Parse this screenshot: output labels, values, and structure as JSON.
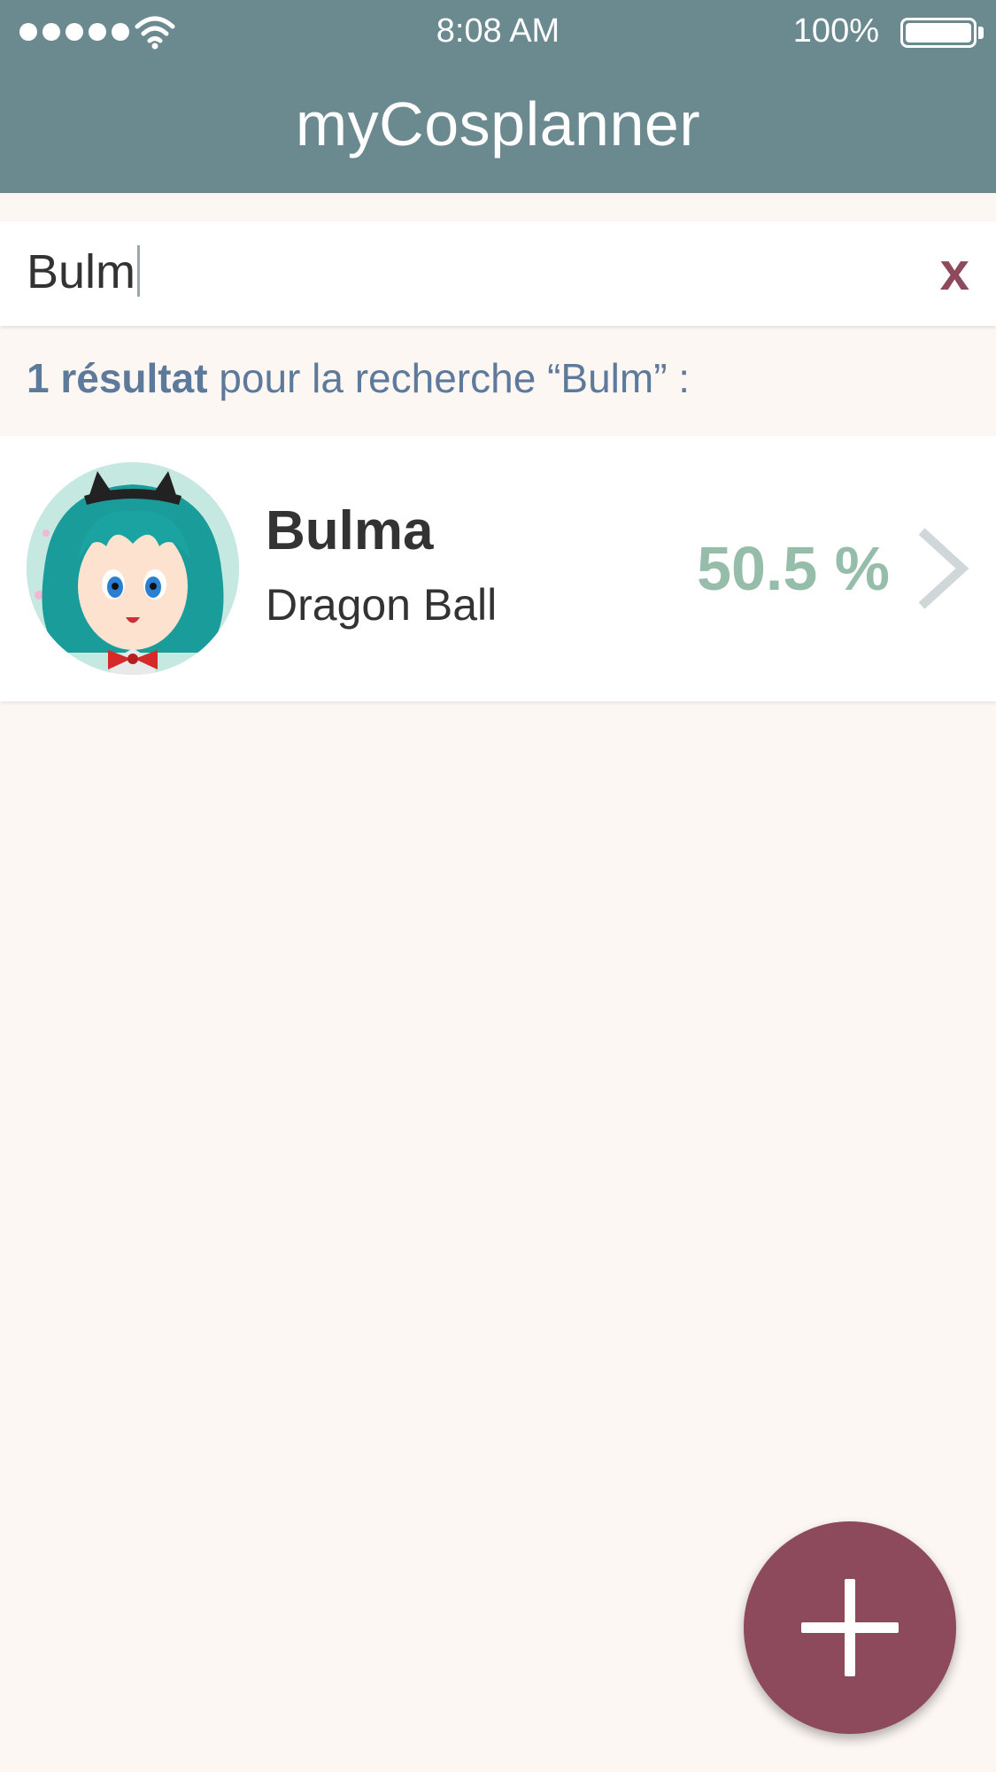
{
  "status_bar": {
    "time": "8:08 AM",
    "battery": "100%"
  },
  "header": {
    "title": "myCosplanner"
  },
  "search": {
    "value": "Bulm",
    "clear_label": "x"
  },
  "results": {
    "count_label": "1 résultat",
    "rest_label": " pour la recherche “Bulm” :"
  },
  "items": [
    {
      "name": "Bulma",
      "series": "Dragon Ball",
      "progress_label": "50.5 %",
      "progress": 50.5
    }
  ],
  "colors": {
    "header": "#6b8a90",
    "background": "#fdf7f4",
    "accent": "#8e4a5d",
    "progress": "#95bdaa",
    "info_text": "#5d7a9a"
  },
  "icons": {
    "signal": "signal-dots-icon",
    "wifi": "wifi-icon",
    "battery": "battery-icon",
    "clear": "close-icon",
    "chevron": "chevron-right-icon",
    "fab": "plus-icon"
  }
}
